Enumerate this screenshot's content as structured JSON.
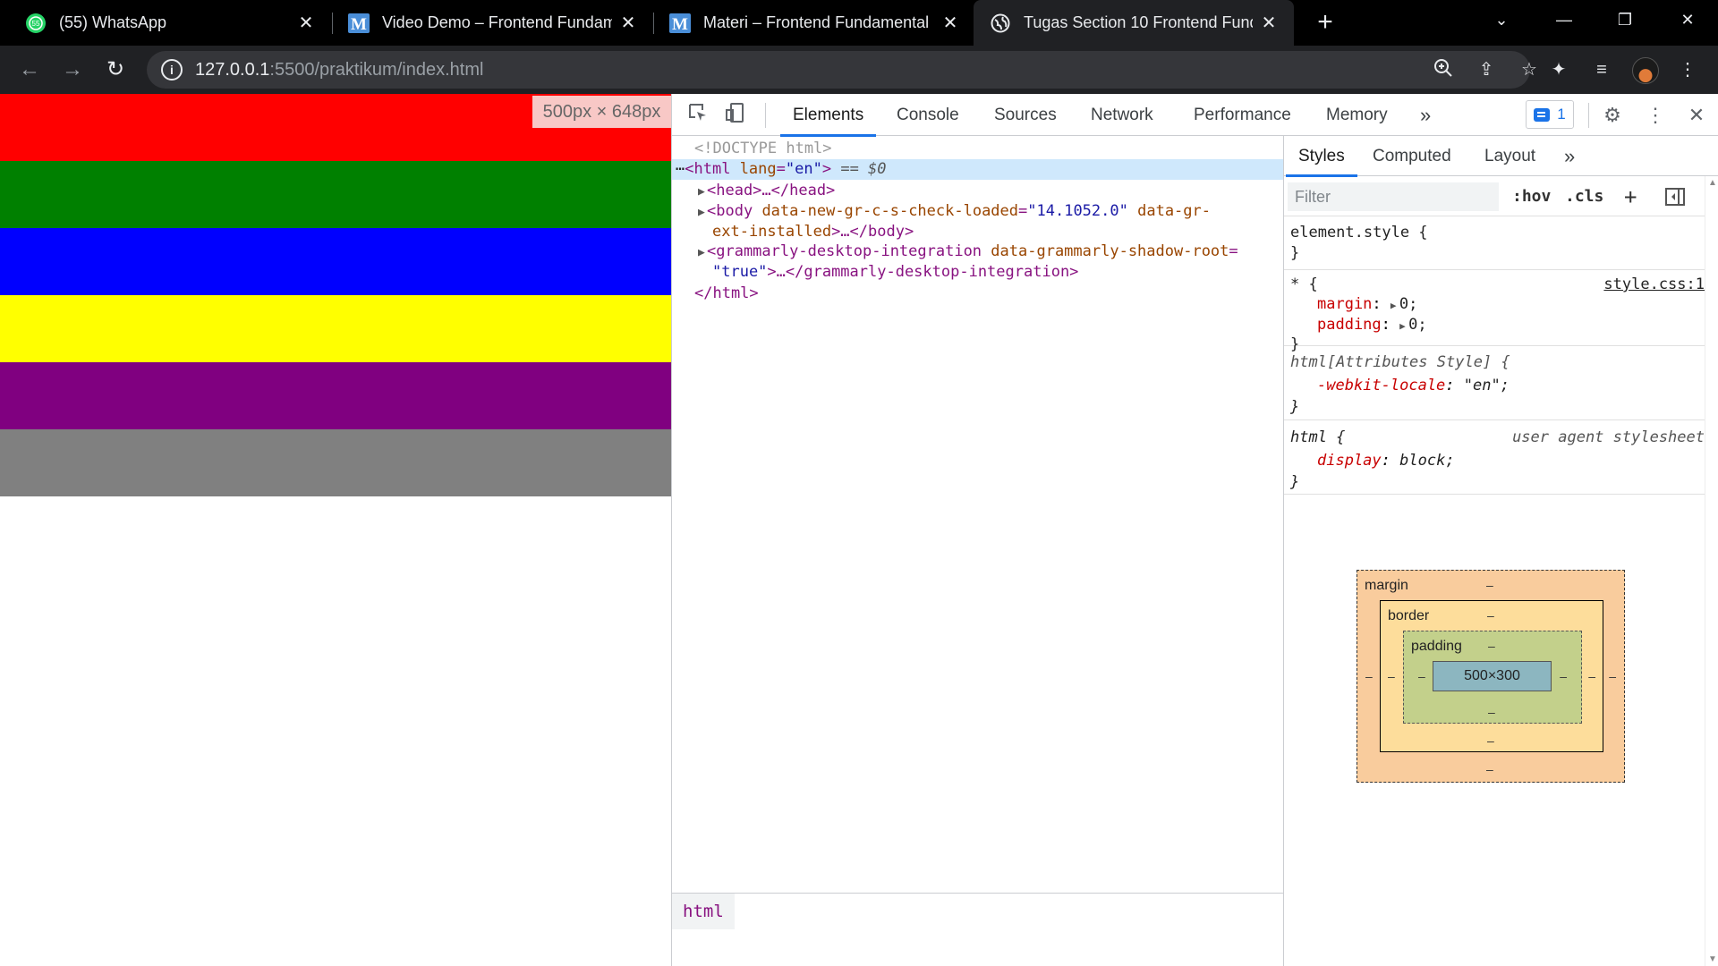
{
  "browser": {
    "tabs": [
      {
        "title": "(55) WhatsApp",
        "favicon": "whatsapp-icon",
        "badge": "55"
      },
      {
        "title": "Video Demo – Frontend Fundam",
        "favicon": "m-logo-icon"
      },
      {
        "title": "Materi – Frontend Fundamental",
        "favicon": "m-logo-icon"
      },
      {
        "title": "Tugas Section 10 Frontend Funda",
        "favicon": "globe-icon"
      }
    ],
    "url_host": "127.0.0.1",
    "url_path": ":5500/praktikum/index.html"
  },
  "page": {
    "stripes": [
      "#ff0000",
      "#008000",
      "#0000ff",
      "#ffff00",
      "#800080",
      "#808080"
    ],
    "size_badge": "500px × 648px"
  },
  "devtools": {
    "tabs": [
      "Elements",
      "Console",
      "Sources",
      "Network",
      "Performance",
      "Memory"
    ],
    "more": "»",
    "issues_count": "1",
    "dom": {
      "doctype": "<!DOCTYPE html>",
      "html_open_tag": "<html",
      "html_attr_name": "lang",
      "html_attr_value": "\"en\"",
      "html_close_bracket": ">",
      "selected_marker": "== $0",
      "head": "<head>…</head>",
      "body_open": "<body",
      "body_attr1_name": "data-new-gr-c-s-check-loaded",
      "body_attr1_value": "\"14.1052.0\"",
      "body_attr2_name_part1": "data-gr-",
      "body_attr2_name_part2": "ext-installed",
      "body_rest": ">…</body>",
      "gram_open": "<grammarly-desktop-integration",
      "gram_attr_name": "data-grammarly-shadow-root",
      "gram_attr_value": "\"true\"",
      "gram_rest": ">…</grammarly-desktop-integration>",
      "html_close": "</html>",
      "breadcrumb": "html"
    },
    "sidebar": {
      "tabs": [
        "Styles",
        "Computed",
        "Layout"
      ],
      "more": "»",
      "filter_placeholder": "Filter",
      "hov": ":hov",
      "cls": ".cls",
      "rules": {
        "element_style": "element.style {",
        "close": "}",
        "universal_selector": "* {",
        "universal_source": "style.css:1",
        "margin_name": "margin",
        "margin_value": "0;",
        "padding_name": "padding",
        "padding_value": "0;",
        "attr_selector": "html[Attributes Style] {",
        "locale_name": "-webkit-locale",
        "locale_value": "\"en\";",
        "html_selector": "html {",
        "ua_label": "user agent stylesheet",
        "display_name": "display",
        "display_value": "block;"
      },
      "box_model": {
        "margin_label": "margin",
        "border_label": "border",
        "padding_label": "padding",
        "content": "500×300",
        "dash": "–"
      }
    }
  }
}
